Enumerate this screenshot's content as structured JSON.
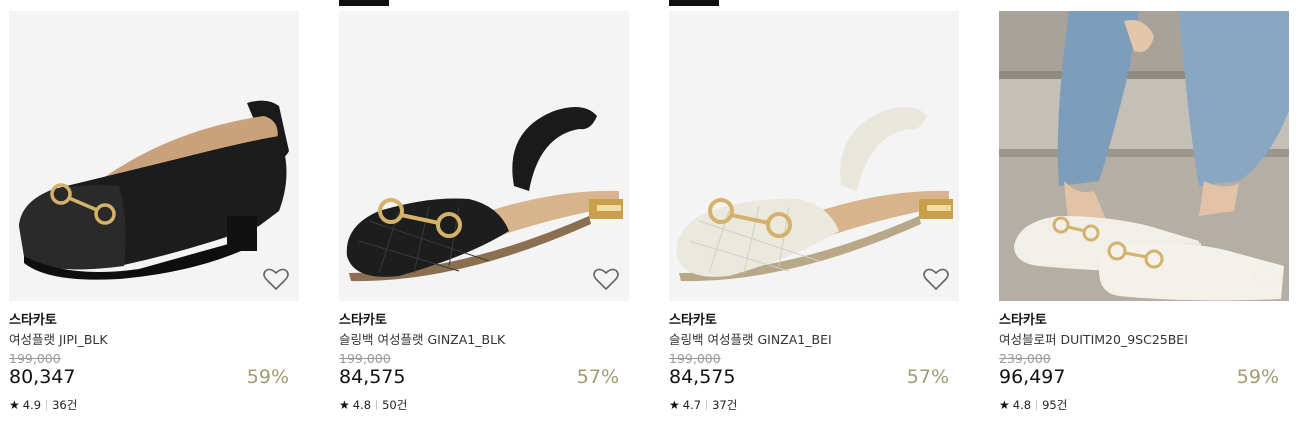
{
  "products": [
    {
      "brand": "스타카토",
      "name": "여성플랫 JIPI_BLK",
      "original_price": "199,000",
      "price": "80,347",
      "discount": "59%",
      "rating": "4.9",
      "reviews": "36건",
      "image": "black-ballet-flat-icon"
    },
    {
      "brand": "스타카토",
      "name": "슬링백 여성플랫 GINZA1_BLK",
      "original_price": "199,000",
      "price": "84,575",
      "discount": "57%",
      "rating": "4.8",
      "reviews": "50건",
      "image": "black-slingback-flat-icon"
    },
    {
      "brand": "스타카토",
      "name": "슬링백 여성플랫 GINZA1_BEI",
      "original_price": "199,000",
      "price": "84,575",
      "discount": "57%",
      "rating": "4.7",
      "reviews": "37건",
      "image": "beige-slingback-flat-icon"
    },
    {
      "brand": "스타카토",
      "name": "여성블로퍼 DUITIM20_9SC25BEI",
      "original_price": "239,000",
      "price": "96,497",
      "discount": "59%",
      "rating": "4.8",
      "reviews": "95건",
      "image": "beige-mule-loafer-photo"
    }
  ],
  "icons": {
    "wishlist": "heart-outline-icon",
    "rating": "star-icon"
  },
  "colors": {
    "discount": "#a39a70",
    "strikethrough": "#9a9a9a",
    "thumb_bg": "#f4f4f4"
  }
}
